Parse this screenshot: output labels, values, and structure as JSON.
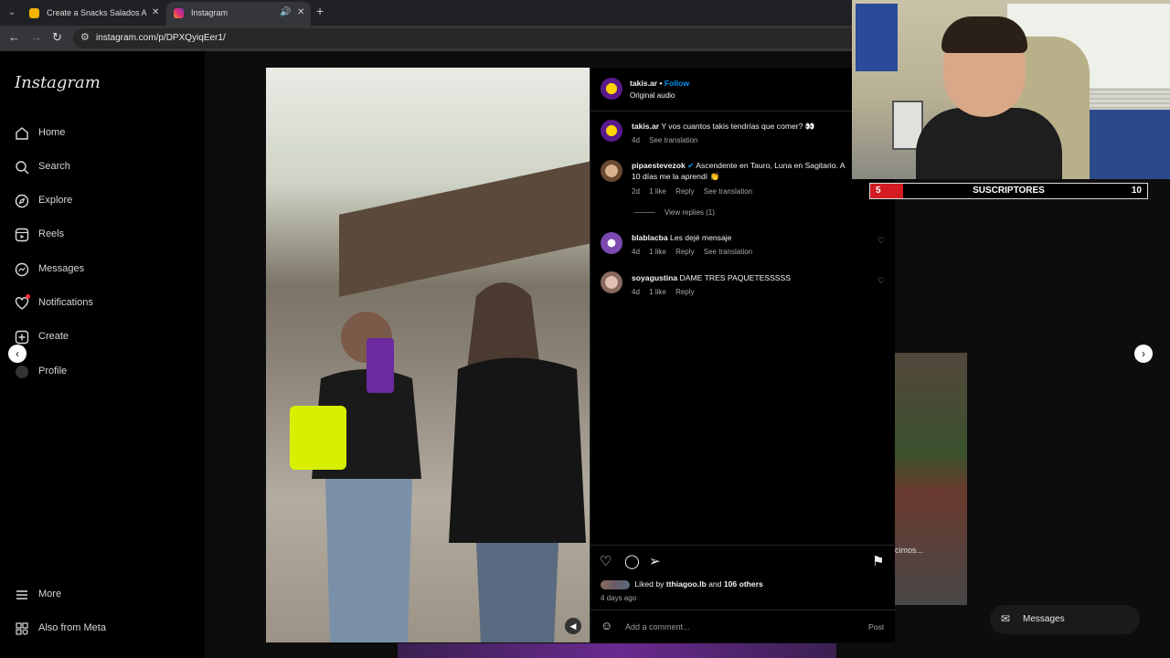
{
  "browser": {
    "tabs": [
      {
        "title": "Create a Snacks Salados Argen"
      },
      {
        "title": "Instagram"
      }
    ],
    "url": "instagram.com/p/DPXQyiqEer1/"
  },
  "sidebar": {
    "logo": "Instagram",
    "items": [
      {
        "label": "Home",
        "icon": "home-icon"
      },
      {
        "label": "Search",
        "icon": "search-icon"
      },
      {
        "label": "Explore",
        "icon": "compass-icon"
      },
      {
        "label": "Reels",
        "icon": "reels-icon"
      },
      {
        "label": "Messages",
        "icon": "messenger-icon"
      },
      {
        "label": "Notifications",
        "icon": "heart-icon"
      },
      {
        "label": "Create",
        "icon": "plus-icon"
      },
      {
        "label": "Profile",
        "icon": "avatar-icon"
      }
    ],
    "more": "More",
    "also_from_meta": "Also from Meta"
  },
  "post": {
    "author": "takis.ar",
    "follow": "Follow",
    "audio": "Original audio",
    "caption_user": "takis.ar",
    "caption_text": "Y vos cuantos takis tendrías que comer? 👀",
    "caption_time": "4d",
    "caption_translate": "See translation",
    "comments": [
      {
        "user": "pipaestevezok",
        "text": "Ascendente en Tauro, Luna en Sagitario. A",
        "text2": "10 días me la aprendí 👏",
        "time": "2d",
        "likes": "1 like",
        "reply": "Reply",
        "translate": "See translation"
      },
      {
        "user": "blablacba",
        "text": "Les dejé mensaje",
        "time": "4d",
        "likes": "1 like",
        "reply": "Reply",
        "translate": "See translation"
      },
      {
        "user": "soyagustina",
        "text": "DAME TRES PAQUETESSSSS",
        "time": "4d",
        "likes": "1 like",
        "reply": "Reply"
      }
    ],
    "view_replies": "View replies (1)",
    "liked_by_prefix": "Liked by",
    "liked_by_user": "tthiagoo.lb",
    "liked_by_and": "and",
    "liked_by_others": "106 others",
    "posted": "4 days ago",
    "add_comment_placeholder": "Add a comment...",
    "post_button": "Post"
  },
  "overlay": {
    "thumb_text": "cimos...",
    "messages": "Messages"
  },
  "stream": {
    "sub_left": "5",
    "sub_label": "SUSCRIPTORES",
    "sub_right": "10",
    "sub_progress": 0.12
  },
  "colors": {
    "accent": "#0095f6",
    "sub_bar": "#d41c24"
  }
}
